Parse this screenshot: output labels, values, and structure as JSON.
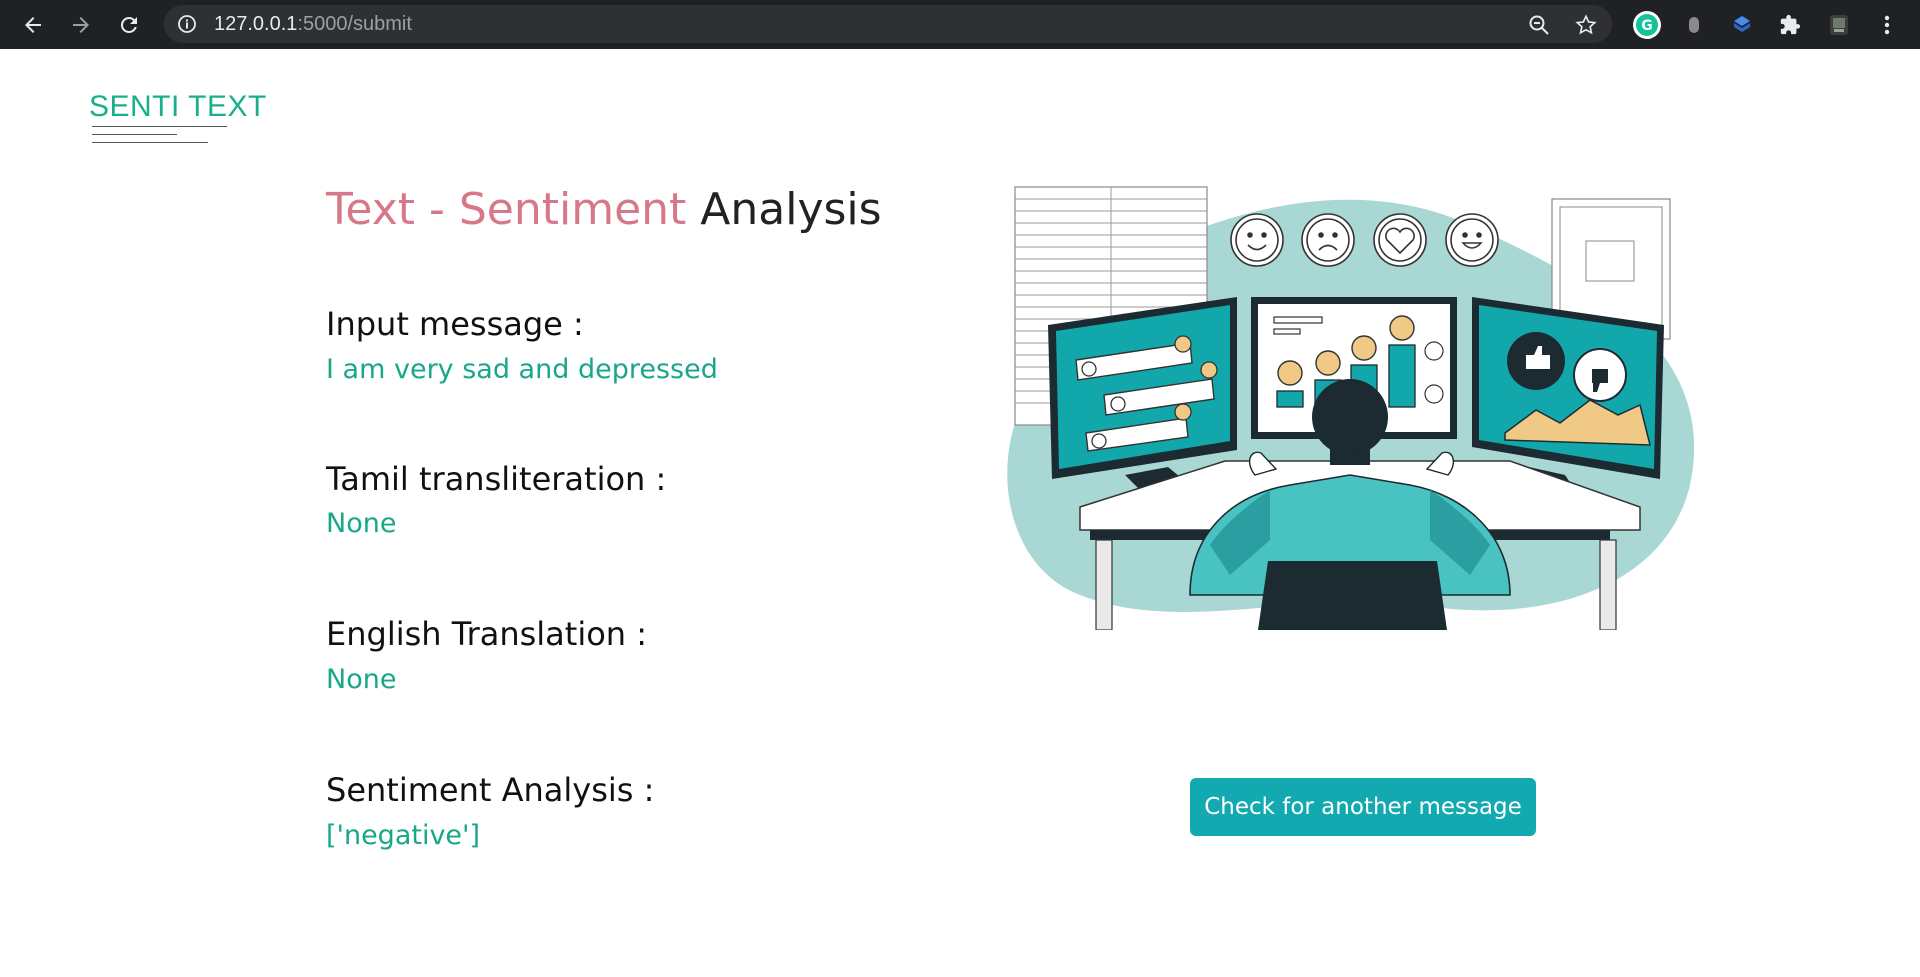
{
  "browser": {
    "url_host": "127.0.0.1",
    "url_rest": ":5000/submit"
  },
  "page": {
    "logo": "SENTI TEXT",
    "title_colored": "Text - Sentiment",
    "title_plain": " Analysis",
    "sections": [
      {
        "label": "Input message :",
        "value": "I am very sad and depressed"
      },
      {
        "label": "Tamil transliteration :",
        "value": "None"
      },
      {
        "label": "English Translation :",
        "value": "None"
      },
      {
        "label": "Sentiment Analysis :",
        "value": "['negative']"
      }
    ],
    "button_label": "Check for another message"
  },
  "colors": {
    "accent_green": "#19a78a",
    "title_pink": "#d6788a",
    "button_teal": "#12aab0"
  }
}
